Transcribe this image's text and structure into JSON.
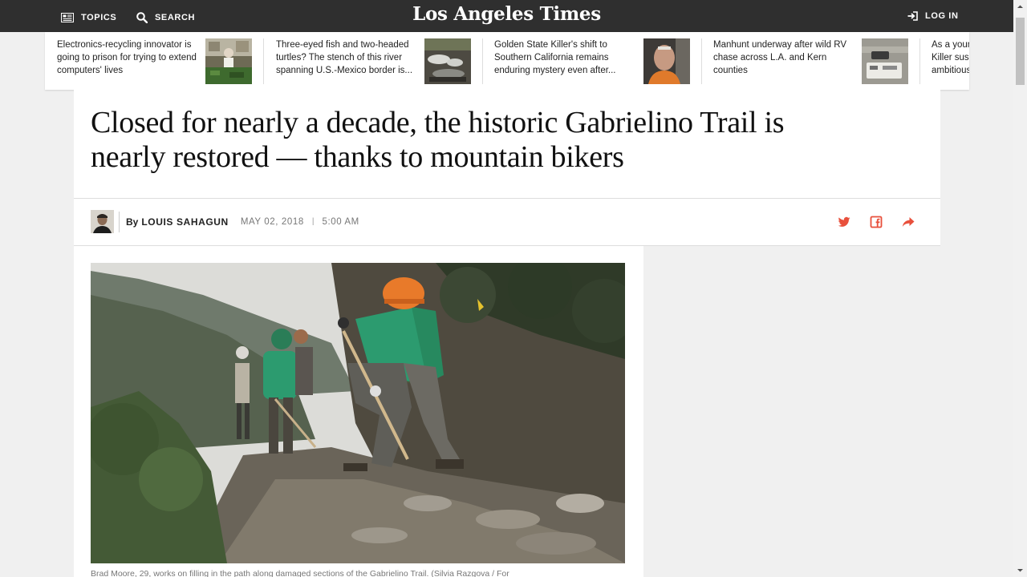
{
  "header": {
    "topics_label": "TOPICS",
    "search_label": "SEARCH",
    "logo_text": "Los Angeles Times",
    "login_label": "LOG IN"
  },
  "related_stories": [
    {
      "text": "Electronics-recycling innovator is going to prison for trying to extend computers' lives",
      "thumb": "recycling-workshop-photo"
    },
    {
      "text": "Three-eyed fish and two-headed turtles? The stench of this river spanning U.S.-Mexico border is...",
      "thumb": "river-trash-photo"
    },
    {
      "text": "Golden State Killer's shift to Southern California remains enduring mystery even after...",
      "thumb": "suspect-mugshot-photo"
    },
    {
      "text": "Manhunt underway after wild RV chase across L.A. and Kern counties",
      "thumb": "rv-aerial-photo"
    },
    {
      "text": "As a young Killer sus ambitious"
    }
  ],
  "article": {
    "headline": "Closed for nearly a decade, the historic Gabrielino Trail is nearly restored — thanks to mountain bikers",
    "byline_prefix": "By",
    "author": "LOUIS SAHAGUN",
    "date": "MAY 02, 2018",
    "pipe": "|",
    "time": "5:00 AM",
    "caption": "Brad Moore, 29, works on filling in the path along damaged sections of the Gabrielino Trail. (Silvia Razgova / For"
  },
  "share": {
    "twitter_icon": "twitter-icon",
    "facebook_icon": "facebook-icon",
    "share_icon": "share-arrow-icon",
    "color": "#e8503c"
  },
  "colors": {
    "topbar": "#2f2f2f",
    "page_bg": "#f0f0f0"
  }
}
